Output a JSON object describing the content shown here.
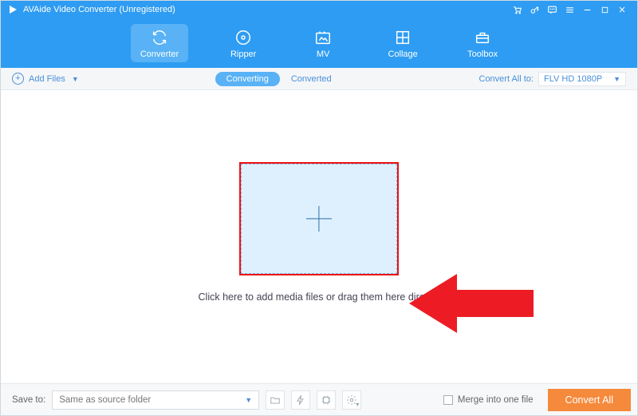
{
  "app": {
    "title": "AVAide Video Converter (Unregistered)"
  },
  "nav": {
    "items": [
      {
        "label": "Converter"
      },
      {
        "label": "Ripper"
      },
      {
        "label": "MV"
      },
      {
        "label": "Collage"
      },
      {
        "label": "Toolbox"
      }
    ],
    "active": 0
  },
  "toolbar": {
    "add_files": "Add Files",
    "tab_converting": "Converting",
    "tab_converted": "Converted",
    "convert_all_to_label": "Convert All to:",
    "format_selected": "FLV HD 1080P"
  },
  "main": {
    "hint": "Click here to add media files or drag them here directly"
  },
  "bottom": {
    "save_to_label": "Save to:",
    "save_to_value": "Same as source folder",
    "merge_label": "Merge into one file",
    "convert_all_button": "Convert All"
  },
  "colors": {
    "primary": "#2e9cf2",
    "accent": "#f58a3c"
  }
}
